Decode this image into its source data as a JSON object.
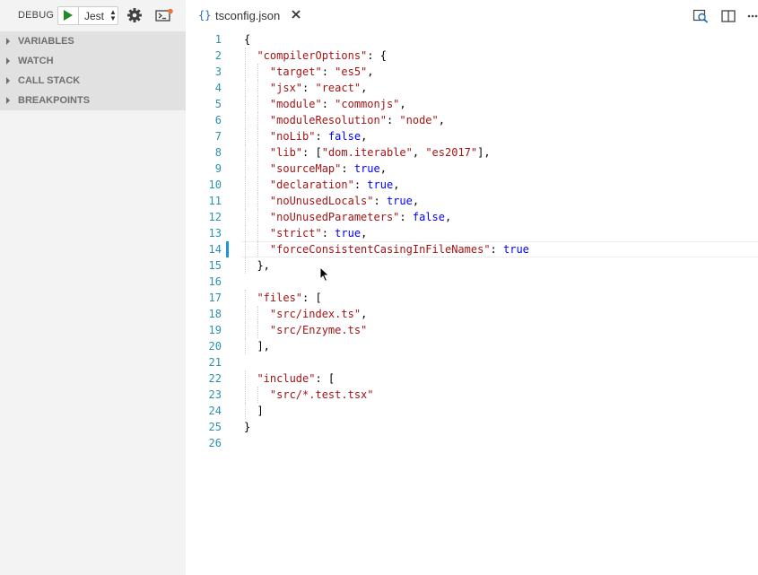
{
  "debug": {
    "label": "DEBUG",
    "config": "Jest",
    "icons": {
      "start": "play-icon",
      "settings": "gear-icon",
      "console": "debug-console-icon"
    },
    "sections": [
      "VARIABLES",
      "WATCH",
      "CALL STACK",
      "BREAKPOINTS"
    ]
  },
  "tab": {
    "icon_text": "{}",
    "title": "tsconfig.json"
  },
  "editor_actions": [
    "open-preview-icon",
    "split-editor-icon",
    "more-actions-icon"
  ],
  "active_line": 14,
  "code": [
    "{",
    "  \"compilerOptions\": {",
    "    \"target\": \"es5\",",
    "    \"jsx\": \"react\",",
    "    \"module\": \"commonjs\",",
    "    \"moduleResolution\": \"node\",",
    "    \"noLib\": false,",
    "    \"lib\": [\"dom.iterable\", \"es2017\"],",
    "    \"sourceMap\": true,",
    "    \"declaration\": true,",
    "    \"noUnusedLocals\": true,",
    "    \"noUnusedParameters\": false,",
    "    \"strict\": true,",
    "    \"forceConsistentCasingInFileNames\": true",
    "  },",
    "",
    "  \"files\": [",
    "    \"src/index.ts\",",
    "    \"src/Enzyme.ts\"",
    "  ],",
    "",
    "  \"include\": [",
    "    \"src/*.test.tsx\"",
    "  ]",
    "}",
    ""
  ],
  "colors": {
    "key": "#a31515",
    "value": "#0000ff",
    "line_number": "#2b91af",
    "play": "#1e8a28",
    "badge": "#e8773a"
  }
}
